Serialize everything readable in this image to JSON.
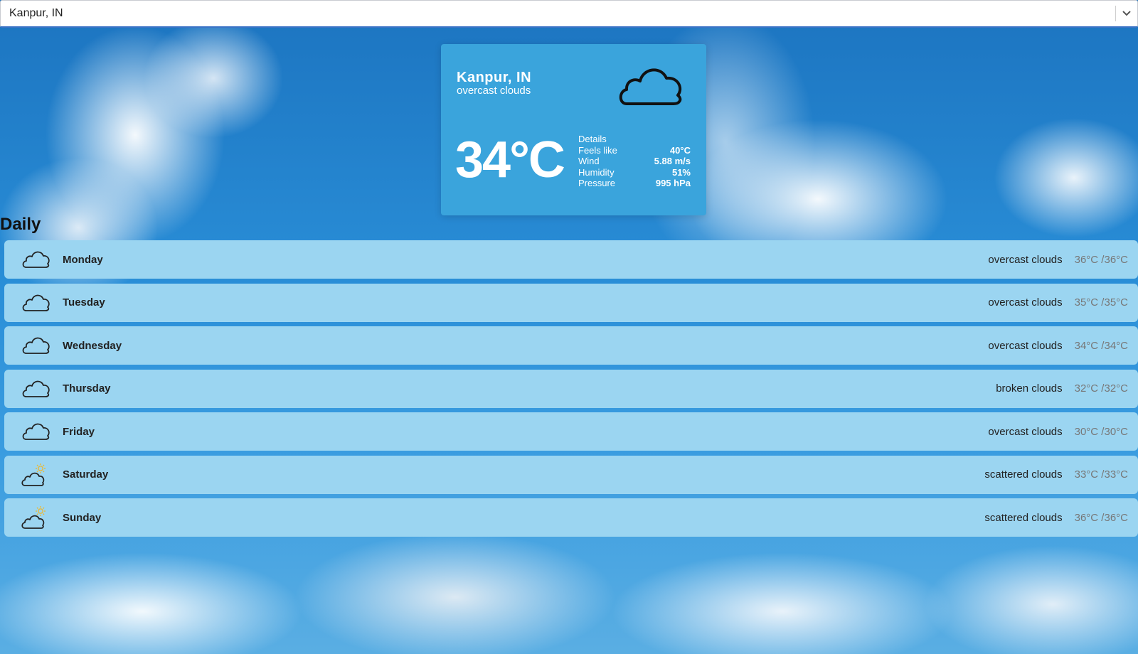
{
  "search": {
    "selected_city": "Kanpur, IN",
    "dropdown_icon": "chevron-down-icon"
  },
  "current": {
    "city": "Kanpur, IN",
    "description": "overcast clouds",
    "icon": "cloud-icon",
    "temperature": "34°C",
    "details_title": "Details",
    "details": [
      {
        "label": "Feels like",
        "value": "40°C"
      },
      {
        "label": "Wind",
        "value": "5.88 m/s"
      },
      {
        "label": "Humidity",
        "value": "51%"
      },
      {
        "label": "Pressure",
        "value": "995 hPa"
      }
    ]
  },
  "daily": {
    "title": "Daily",
    "days": [
      {
        "day": "Monday",
        "condition": "overcast clouds",
        "range": "36°C /36°C",
        "icon": "cloud-icon"
      },
      {
        "day": "Tuesday",
        "condition": "overcast clouds",
        "range": "35°C /35°C",
        "icon": "cloud-icon"
      },
      {
        "day": "Wednesday",
        "condition": "overcast clouds",
        "range": "34°C /34°C",
        "icon": "cloud-icon"
      },
      {
        "day": "Thursday",
        "condition": "broken clouds",
        "range": "32°C /32°C",
        "icon": "cloud-icon"
      },
      {
        "day": "Friday",
        "condition": "overcast clouds",
        "range": "30°C /30°C",
        "icon": "cloud-icon"
      },
      {
        "day": "Saturday",
        "condition": "scattered clouds",
        "range": "33°C /33°C",
        "icon": "sun-cloud-icon"
      },
      {
        "day": "Sunday",
        "condition": "scattered clouds",
        "range": "36°C /36°C",
        "icon": "sun-cloud-icon"
      }
    ]
  },
  "colors": {
    "card_bg": "#3aa4dc",
    "row_bg": "#9bd5f1",
    "sun": "#e8b93a"
  }
}
